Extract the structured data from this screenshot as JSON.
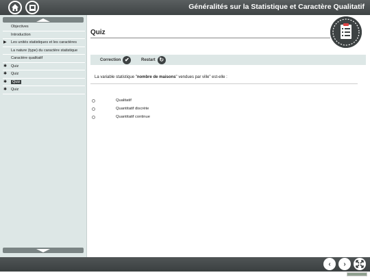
{
  "header": {
    "title": "Généralités sur la Statistique et Caractère Qualitatif"
  },
  "icons": {
    "home": "home-icon",
    "document": "document-icon",
    "badge": "checklist-icon"
  },
  "sidebar": {
    "items": [
      {
        "label": "Objectives",
        "icon": ""
      },
      {
        "label": "Introduction",
        "icon": ""
      },
      {
        "label": "Les unités statistiques et les caractères",
        "icon": "▶"
      },
      {
        "label": "La nature (type) du caractère statistique",
        "icon": ""
      },
      {
        "label": "Caractère qualitatif",
        "icon": ""
      },
      {
        "label": "Quiz",
        "icon": "✱"
      },
      {
        "label": "Quiz",
        "icon": "✱"
      },
      {
        "label": "Quiz",
        "icon": "✱"
      },
      {
        "label": "Quiz",
        "icon": "✱"
      }
    ]
  },
  "quiz": {
    "title": "Quiz",
    "correction_label": "Correction",
    "restart_label": "Restart",
    "question_pre": "La variable statistique \"",
    "question_bold": "nombre de maisons",
    "question_post": "\" vendues par ville\" est-elle :",
    "options": [
      "Qualitatif",
      "Quantitatif discrète",
      "Quantitatif continue"
    ]
  },
  "colors": {
    "bar": "#474c4d",
    "sidebar": "#dde7e6",
    "active": "#3b4142"
  }
}
